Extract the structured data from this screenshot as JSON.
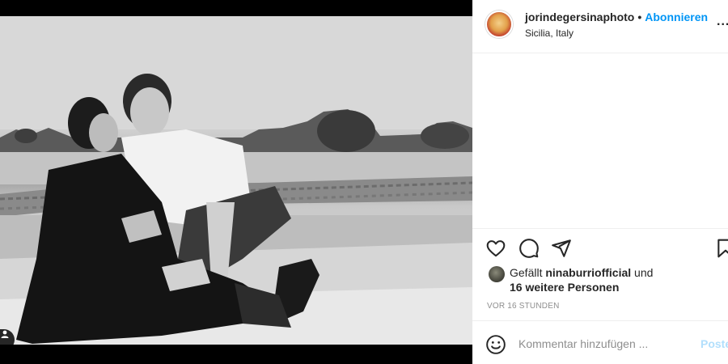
{
  "post": {
    "username": "jorindegersinaphoto",
    "separator": "•",
    "follow_label": "Abonnieren",
    "location": "Sicilia, Italy",
    "more_label": "..."
  },
  "likes": {
    "prefix": "Gefällt ",
    "liker": "ninaburriofficial",
    "conjunction": " und",
    "others": "16 weitere Personen"
  },
  "timestamp": "VOR 16 STUNDEN",
  "comment": {
    "placeholder": "Kommentar hinzufügen ...",
    "post_label": "Posten"
  },
  "icons": {
    "like": "heart-icon",
    "comment": "speech-bubble-icon",
    "share": "paper-plane-icon",
    "save": "bookmark-icon",
    "emoji": "smiley-icon",
    "tag": "user-tag-icon"
  },
  "colors": {
    "accent": "#0095f6",
    "post_disabled": "#b2dffc",
    "text": "#262626",
    "muted": "#8e8e8e"
  }
}
